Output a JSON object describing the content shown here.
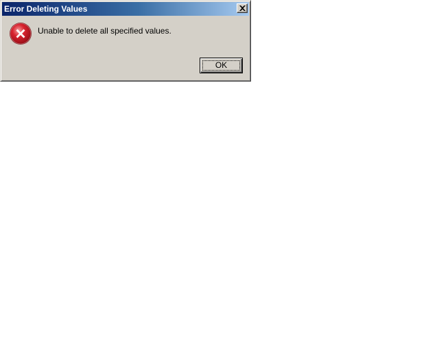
{
  "dialog": {
    "title": "Error Deleting Values",
    "message": "Unable to delete all specified values.",
    "ok_label": "OK",
    "icon": "error-icon",
    "close_icon": "close-icon"
  },
  "colors": {
    "titlebar_start": "#0a246a",
    "titlebar_end": "#a6caf0",
    "dialog_face": "#d4d0c8",
    "error_red": "#c8102e"
  }
}
